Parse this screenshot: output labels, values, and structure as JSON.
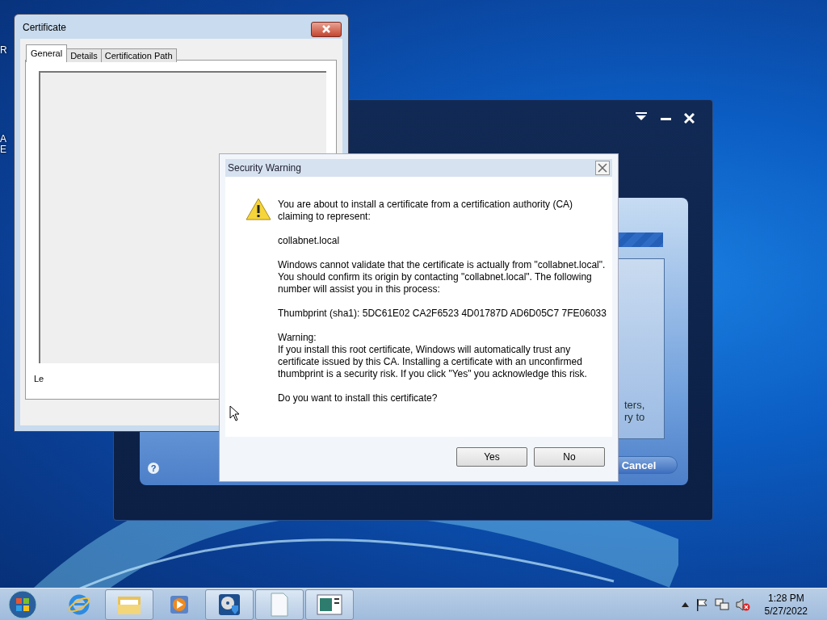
{
  "desktop_icons": [
    {
      "label": "R"
    },
    {
      "label": "A"
    },
    {
      "label": "E"
    }
  ],
  "certificate_window": {
    "title": "Certificate",
    "tabs": [
      {
        "label": "General",
        "selected": true
      },
      {
        "label": "Details",
        "selected": false
      },
      {
        "label": "Certification Path",
        "selected": false
      }
    ],
    "partial_text": "Le"
  },
  "installer_window": {
    "text_lines": [
      "ters,",
      "ry to"
    ],
    "cancel_button": "Cancel",
    "help_glyph": "?"
  },
  "security_warning": {
    "title": "Security Warning",
    "paragraphs": [
      "You are about to install a certificate from a certification authority (CA) claiming to represent:",
      "collabnet.local",
      "Windows cannot validate that the certificate is actually from \"collabnet.local\". You should confirm its origin by contacting \"collabnet.local\". The following number will assist you in this process:",
      "Thumbprint (sha1): 5DC61E02 CA2F6523 4D01787D AD6D05C7 7FE06033",
      "Warning:\nIf you install this root certificate, Windows will automatically trust any certificate issued by this CA. Installing a certificate with an unconfirmed thumbprint is a security risk. If you click \"Yes\" you acknowledge this risk.",
      "Do you want to install this certificate?"
    ],
    "buttons": [
      "Yes",
      "No"
    ]
  },
  "taskbar": {
    "items": [
      {
        "kind": "ie",
        "framed": false
      },
      {
        "kind": "folder",
        "framed": true
      },
      {
        "kind": "media",
        "framed": false
      },
      {
        "kind": "disc",
        "framed": true
      },
      {
        "kind": "page",
        "framed": true
      },
      {
        "kind": "window",
        "framed": true
      }
    ],
    "time": "1:28 PM",
    "date": "5/27/2022"
  }
}
